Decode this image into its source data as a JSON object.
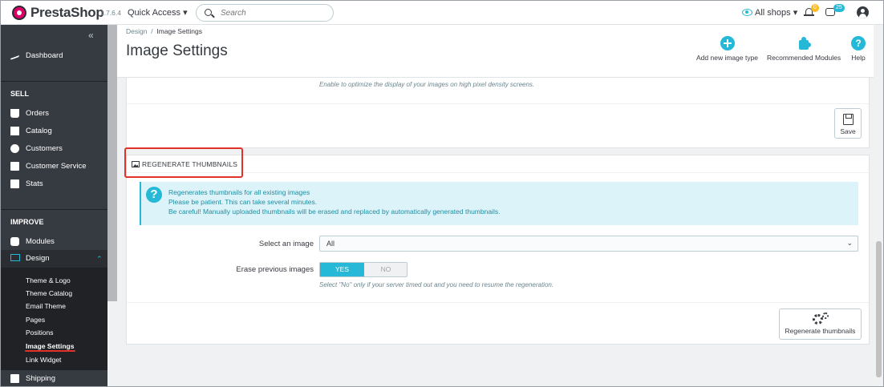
{
  "header": {
    "brand": "PrestaShop",
    "version": "1.7.6.4",
    "quick_access": "Quick Access ▾",
    "search_placeholder": "Search",
    "shop_selector": "All shops ▾",
    "notifications_badge": "0",
    "messages_badge": "25"
  },
  "sidebar": {
    "collapse_glyph": "«",
    "dashboard": "Dashboard",
    "section_sell": "SELL",
    "sell_items": [
      "Orders",
      "Catalog",
      "Customers",
      "Customer Service",
      "Stats"
    ],
    "section_improve": "IMPROVE",
    "modules": "Modules",
    "design": "Design",
    "design_sub": [
      "Theme & Logo",
      "Theme Catalog",
      "Email Theme",
      "Pages",
      "Positions",
      "Image Settings",
      "Link Widget"
    ],
    "shipping": "Shipping"
  },
  "page": {
    "breadcrumb_parent": "Design",
    "breadcrumb_sep": "/",
    "breadcrumb_current": "Image Settings",
    "title": "Image Settings",
    "toolbar": {
      "add": "Add new image type",
      "modules": "Recommended Modules",
      "help": "Help",
      "help_glyph": "?"
    }
  },
  "panel_top": {
    "hint": "Enable to optimize the display of your images on high pixel density screens.",
    "save": "Save"
  },
  "regenerate": {
    "title": "REGENERATE THUMBNAILS",
    "alert_glyph": "?",
    "alert_lines": [
      "Regenerates thumbnails for all existing images",
      "Please be patient. This can take several minutes.",
      "Be careful! Manually uploaded thumbnails will be erased and replaced by automatically generated thumbnails."
    ],
    "select_label": "Select an image",
    "select_value": "All",
    "erase_label": "Erase previous images",
    "yes": "YES",
    "no": "NO",
    "help": "Select \"No\" only if your server timed out and you need to resume the regeneration.",
    "button": "Regenerate thumbnails"
  },
  "colors": {
    "accent": "#25b9d7",
    "sidebar": "#363a41",
    "highlight": "#e1322a"
  }
}
